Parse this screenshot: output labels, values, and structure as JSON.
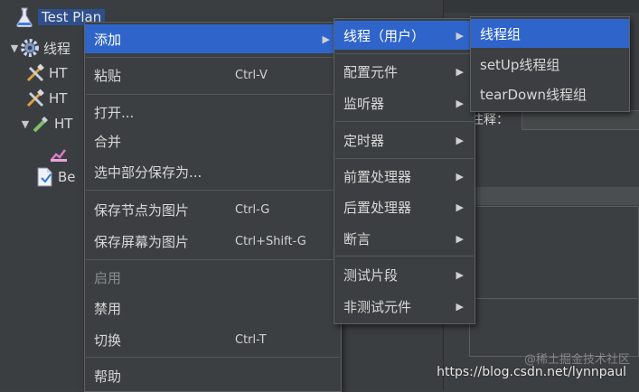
{
  "tree": {
    "items": [
      {
        "label": "Test Plan",
        "expander": ""
      },
      {
        "label": "线程",
        "expander": "▼"
      },
      {
        "label": "HT",
        "expander": ""
      },
      {
        "label": "HT",
        "expander": ""
      },
      {
        "label": "HT",
        "expander": "▼"
      },
      {
        "label": "",
        "expander": ""
      },
      {
        "label": "Be",
        "expander": ""
      }
    ]
  },
  "right_pane": {
    "comment_label": "注释："
  },
  "context_menu": {
    "items": [
      {
        "label": "添加",
        "shortcut": "",
        "arrow": "▶"
      },
      {
        "label": "粘贴",
        "shortcut": "Ctrl-V"
      },
      {
        "label": "打开...",
        "shortcut": ""
      },
      {
        "label": "合并",
        "shortcut": ""
      },
      {
        "label": "选中部分保存为...",
        "shortcut": ""
      },
      {
        "label": "保存节点为图片",
        "shortcut": "Ctrl-G"
      },
      {
        "label": "保存屏幕为图片",
        "shortcut": "Ctrl+Shift-G"
      },
      {
        "label": "启用",
        "shortcut": ""
      },
      {
        "label": "禁用",
        "shortcut": ""
      },
      {
        "label": "切换",
        "shortcut": "Ctrl-T"
      },
      {
        "label": "帮助",
        "shortcut": ""
      }
    ]
  },
  "add_submenu": {
    "items": [
      {
        "label": "线程（用户）",
        "arrow": "▶"
      },
      {
        "label": "配置元件",
        "arrow": "▶"
      },
      {
        "label": "监听器",
        "arrow": "▶"
      },
      {
        "label": "定时器",
        "arrow": "▶"
      },
      {
        "label": "前置处理器",
        "arrow": "▶"
      },
      {
        "label": "后置处理器",
        "arrow": "▶"
      },
      {
        "label": "断言",
        "arrow": "▶"
      },
      {
        "label": "测试片段",
        "arrow": "▶"
      },
      {
        "label": "非测试元件",
        "arrow": "▶"
      }
    ]
  },
  "threads_submenu": {
    "items": [
      {
        "label": "线程组"
      },
      {
        "label": "setUp线程组"
      },
      {
        "label": "tearDown线程组"
      }
    ]
  },
  "watermark": {
    "url": "https://blog.csdn.net/lynnpaul",
    "cn": "@稀土掘金技术社区"
  },
  "colors": {
    "highlight": "#2f65ca",
    "menu_bg": "#3c3f41",
    "tree_selection": "#2f4f8c"
  }
}
